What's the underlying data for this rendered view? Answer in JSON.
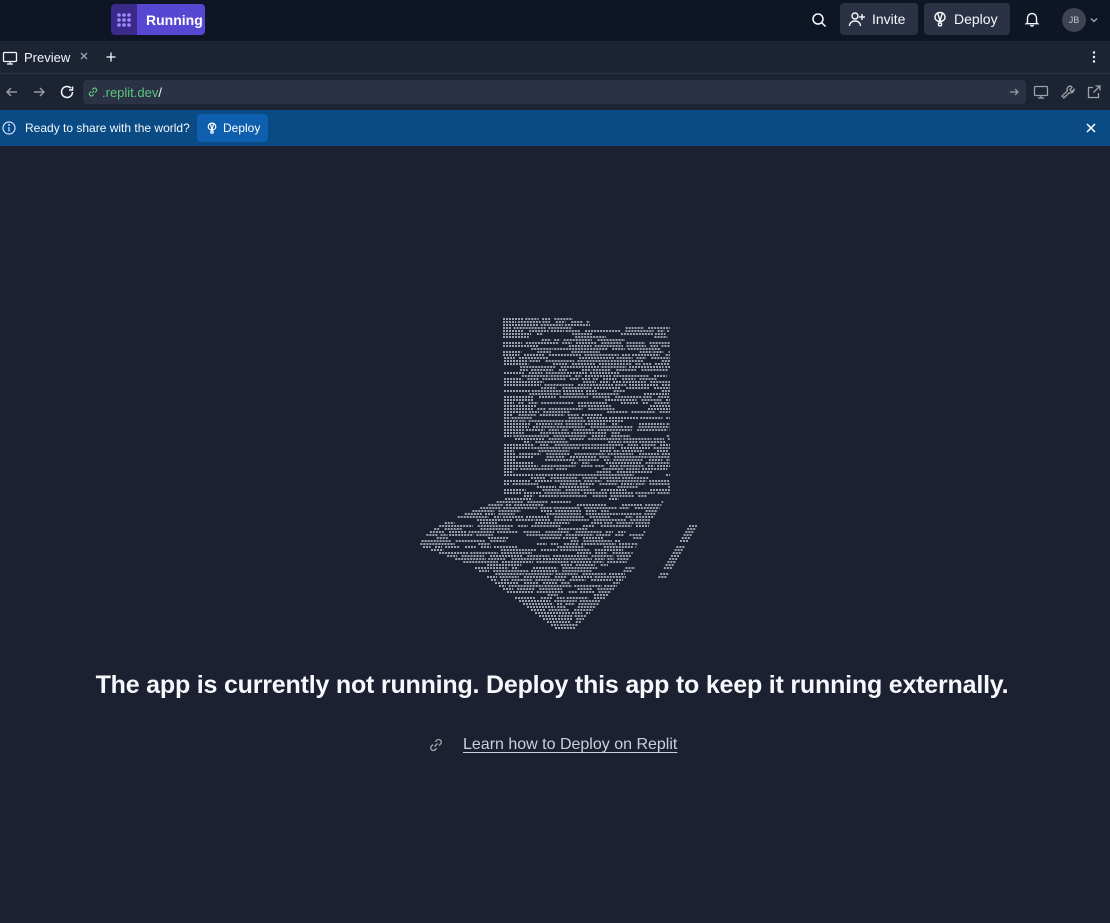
{
  "topbar": {
    "run_label": "Running",
    "invite_label": "Invite",
    "deploy_label": "Deploy",
    "avatar_initials": "JB",
    "icons": [
      "run-grid-icon",
      "search-icon",
      "add-user-icon",
      "deploy-balloon-icon",
      "bell-icon",
      "chevron-down-icon"
    ]
  },
  "tabs": {
    "active_tab": "Preview"
  },
  "urlbar": {
    "host": ".replit.dev",
    "path": "/"
  },
  "banner": {
    "message": "Ready to share with the world?",
    "deploy_label": "Deploy"
  },
  "main": {
    "headline": "The app is currently not running. Deploy this app to keep it running externally.",
    "learn_link": "Learn how to Deploy on Replit"
  },
  "colors": {
    "accent_run": "#5847d3",
    "banner": "#0a4a85",
    "url_host": "#58c878",
    "background": "#1c2030"
  }
}
